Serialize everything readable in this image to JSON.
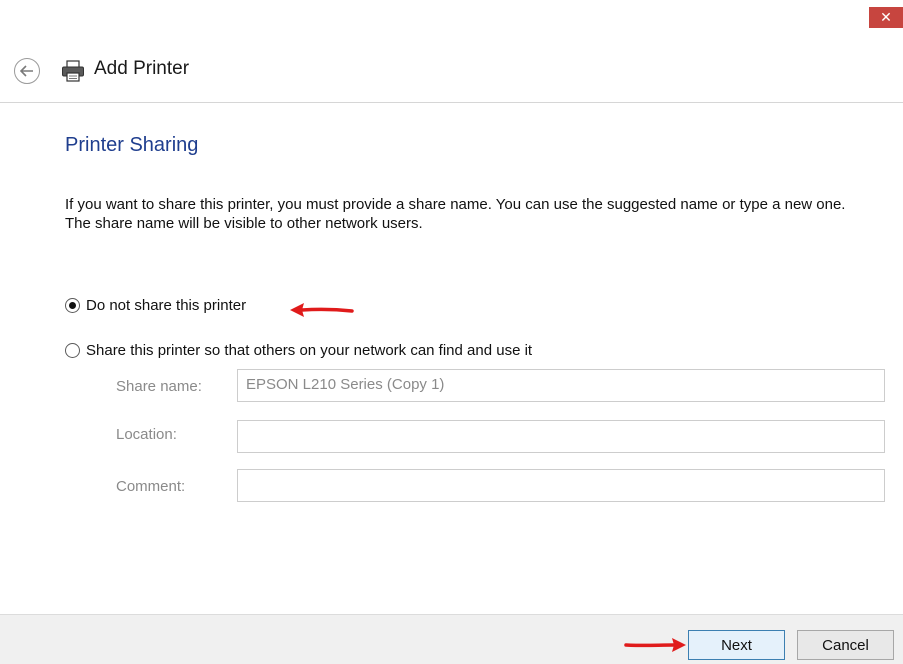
{
  "window": {
    "title": "Add Printer",
    "close_glyph": "✕"
  },
  "page": {
    "heading": "Printer Sharing",
    "instructions": "If you want to share this printer, you must provide a share name. You can use the suggested name or type a new one. The share name will be visible to other network users."
  },
  "sharing_options": {
    "do_not_share_label": "Do not share this printer",
    "share_label": "Share this printer so that others on your network can find and use it",
    "selected": "do_not_share"
  },
  "fields": {
    "share_name_label": "Share name:",
    "share_name_value": "EPSON L210 Series (Copy 1)",
    "location_label": "Location:",
    "location_value": "",
    "comment_label": "Comment:",
    "comment_value": ""
  },
  "buttons": {
    "next_label": "Next",
    "cancel_label": "Cancel"
  },
  "colors": {
    "heading": "#1f3e8e",
    "close_button": "#c7453f",
    "annotation_arrow": "#e01b1b"
  },
  "icons": {
    "back": "back-arrow-icon",
    "printer": "printer-icon",
    "close": "close-icon",
    "annotation": "red-arrow-icon"
  }
}
